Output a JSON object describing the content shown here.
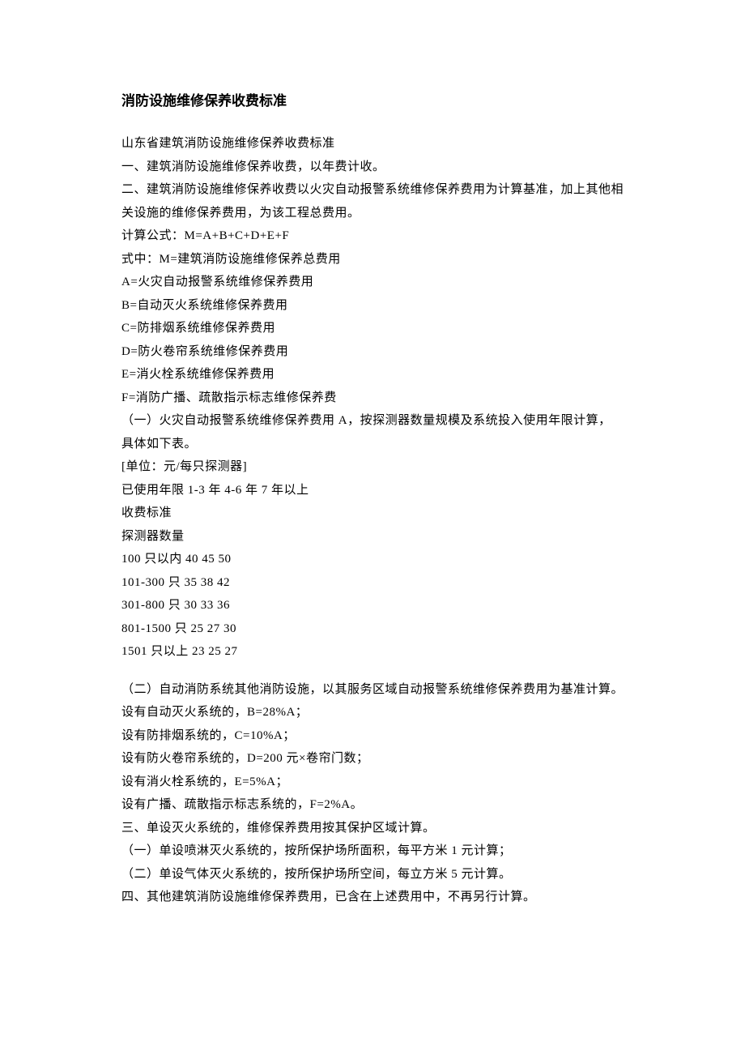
{
  "title": "消防设施维修保养收费标准",
  "lines": [
    "山东省建筑消防设施维修保养收费标准",
    "一、建筑消防设施维修保养收费，以年费计收。",
    "二、建筑消防设施维修保养收费以火灾自动报警系统维修保养费用为计算基准，加上其他相关设施的维修保养费用，为该工程总费用。",
    "计算公式：M=A+B+C+D+E+F",
    "式中：M=建筑消防设施维修保养总费用",
    "A=火灾自动报警系统维修保养费用",
    "B=自动灭火系统维修保养费用",
    "C=防排烟系统维修保养费用",
    "D=防火卷帘系统维修保养费用",
    "E=消火栓系统维修保养费用",
    "F=消防广播、疏散指示标志维修保养费",
    "（一）火灾自动报警系统维修保养费用 A，按探测器数量规模及系统投入使用年限计算，具体如下表。",
    "[单位：元/每只探测器]",
    "已使用年限 1-3 年 4-6 年 7 年以上",
    "收费标准",
    "探测器数量",
    "100 只以内 40 45 50",
    "101-300 只 35 38 42",
    "301-800 只 30 33 36",
    "801-1500 只 25 27 30",
    "1501 只以上 23 25 27"
  ],
  "lines2": [
    "（二）自动消防系统其他消防设施，以其服务区域自动报警系统维修保养费用为基准计算。",
    "设有自动灭火系统的，B=28%A；",
    "设有防排烟系统的，C=10%A；",
    "设有防火卷帘系统的，D=200 元×卷帘门数；",
    "设有消火栓系统的，E=5%A；",
    "设有广播、疏散指示标志系统的，F=2%A。",
    "三、单设灭火系统的，维修保养费用按其保护区域计算。",
    "（一）单设喷淋灭火系统的，按所保护场所面积，每平方米 1 元计算；",
    "（二）单设气体灭火系统的，按所保护场所空间，每立方米 5 元计算。",
    "四、其他建筑消防设施维修保养费用，已含在上述费用中，不再另行计算。"
  ]
}
